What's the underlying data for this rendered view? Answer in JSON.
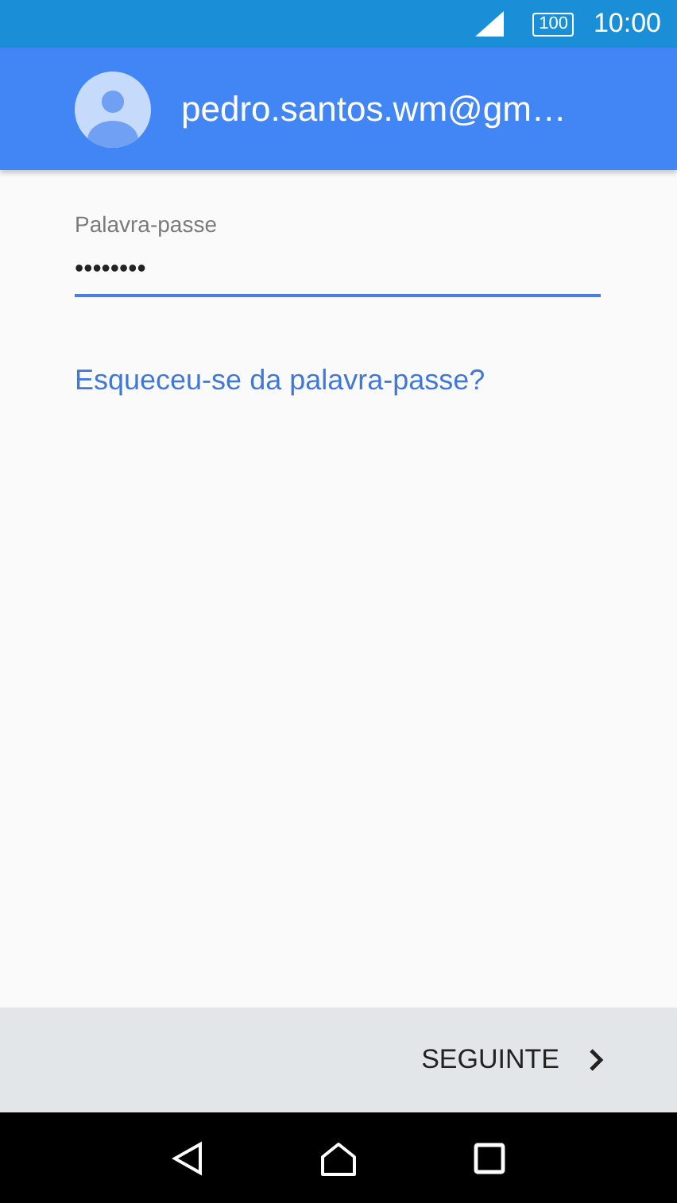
{
  "status_bar": {
    "battery": "100",
    "time": "10:00"
  },
  "account": {
    "email": "pedro.santos.wm@gm…"
  },
  "password_field": {
    "label": "Palavra-passe",
    "value": "••••••••"
  },
  "forgot_link": "Esqueceu-se da palavra-passe?",
  "next_button": {
    "label": "SEGUINTE"
  }
}
